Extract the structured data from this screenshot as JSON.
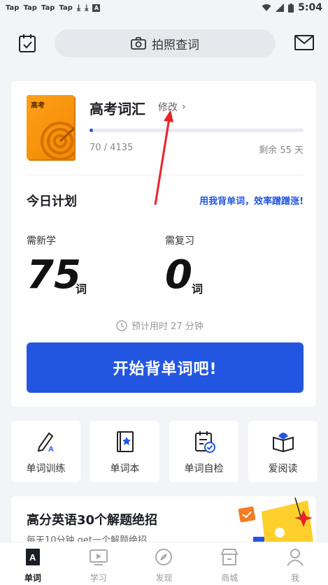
{
  "status_bar": {
    "apps": [
      "Tap",
      "Tap",
      "Tap",
      "Tap"
    ],
    "time": "5:04"
  },
  "header": {
    "search_label": "拍照查词"
  },
  "book": {
    "cover_label": "高考",
    "title": "高考词汇",
    "edit_label": "修改",
    "progress_fraction": 0.017,
    "progress_text": "70 / 4135",
    "days_left": "剩余 55 天"
  },
  "plan": {
    "title": "今日计划",
    "slogan": "用我背单词，效率蹭蹭涨!",
    "new_label": "需新学",
    "new_count": "75",
    "new_unit": "词",
    "review_label": "需复习",
    "review_count": "0",
    "review_unit": "词",
    "estimate": "预计用时 27 分钟",
    "start_button": "开始背单词吧!"
  },
  "tools": [
    {
      "label": "单词训练",
      "icon": "pen-a-icon"
    },
    {
      "label": "单词本",
      "icon": "star-book-icon"
    },
    {
      "label": "单词自检",
      "icon": "checklist-icon"
    },
    {
      "label": "爱阅读",
      "icon": "open-book-icon"
    }
  ],
  "promo": {
    "title": "高分英语30个解题绝招",
    "subtitle": "每天10分钟 get一个解题绝招"
  },
  "nav": [
    {
      "label": "单词",
      "icon": "word-book-icon",
      "active": true
    },
    {
      "label": "学习",
      "icon": "video-icon",
      "active": false
    },
    {
      "label": "发现",
      "icon": "compass-icon",
      "active": false
    },
    {
      "label": "商城",
      "icon": "store-icon",
      "active": false
    },
    {
      "label": "我",
      "icon": "profile-icon",
      "active": false
    }
  ],
  "colors": {
    "accent": "#2356e0",
    "book_orange": "#f08a00",
    "annotation_red": "#e8222b"
  }
}
